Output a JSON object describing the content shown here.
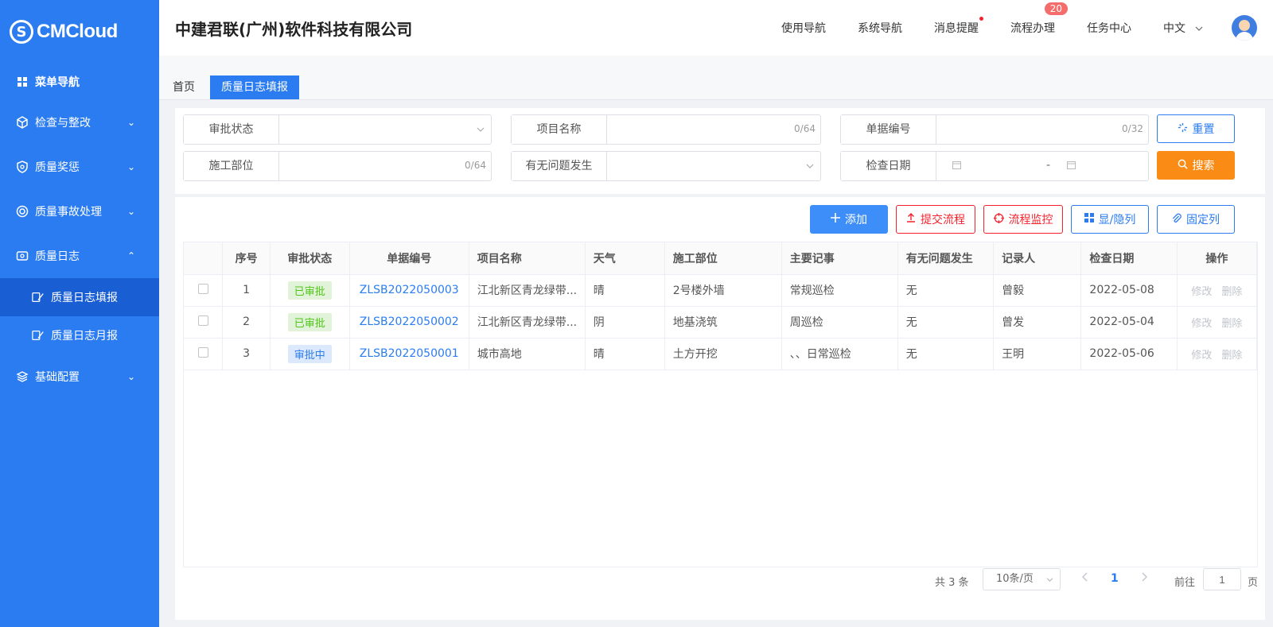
{
  "sidebar": {
    "logo_mark": "S",
    "logo_text": "CMCloud",
    "nav_title": "菜单导航",
    "items": [
      {
        "label": "检查与整改",
        "chevron": "⌄"
      },
      {
        "label": "质量奖惩",
        "chevron": "⌄"
      },
      {
        "label": "质量事故处理",
        "chevron": "⌄"
      },
      {
        "label": "质量日志",
        "chevron": "⌃"
      },
      {
        "label": "基础配置",
        "chevron": "⌄"
      }
    ],
    "sub_items": [
      {
        "label": "质量日志填报"
      },
      {
        "label": "质量日志月报"
      }
    ]
  },
  "header": {
    "company": "中建君联(广州)软件科技有限公司",
    "nav": [
      "使用导航",
      "系统导航",
      "消息提醒",
      "流程办理",
      "任务中心"
    ],
    "process_badge": "20",
    "language": "中文"
  },
  "tabs": {
    "home": "首页",
    "active": "质量日志填报"
  },
  "filters": {
    "approval_status": {
      "label": "审批状态"
    },
    "project_name": {
      "label": "项目名称",
      "counter": "0/64"
    },
    "doc_no": {
      "label": "单据编号",
      "counter": "0/32"
    },
    "construction_part": {
      "label": "施工部位",
      "counter": "0/64"
    },
    "has_issue": {
      "label": "有无问题发生"
    },
    "check_date": {
      "label": "检查日期",
      "separator": "-"
    },
    "reset_label": "重置",
    "search_label": "搜索"
  },
  "actions": {
    "add": "添加",
    "submit_flow": "提交流程",
    "flow_monitor": "流程监控",
    "show_hide_cols": "显/隐列",
    "pin_cols": "固定列"
  },
  "table": {
    "headers": [
      "序号",
      "审批状态",
      "单据编号",
      "项目名称",
      "天气",
      "施工部位",
      "主要记事",
      "有无问题发生",
      "记录人",
      "检查日期",
      "操作"
    ],
    "rows": [
      {
        "no": "1",
        "status": "已审批",
        "status_type": "ok",
        "doc": "ZLSB2022050003",
        "project": "江北新区青龙绿带...",
        "weather": "晴",
        "part": "2号楼外墙",
        "note": "常规巡检",
        "issue": "无",
        "recorder": "曾毅",
        "date": "2022-05-08",
        "edit": "修改",
        "del": "删除"
      },
      {
        "no": "2",
        "status": "已审批",
        "status_type": "ok",
        "doc": "ZLSB2022050002",
        "project": "江北新区青龙绿带...",
        "weather": "阴",
        "part": "地基浇筑",
        "note": "周巡检",
        "issue": "无",
        "recorder": "曾发",
        "date": "2022-05-04",
        "edit": "修改",
        "del": "删除"
      },
      {
        "no": "3",
        "status": "审批中",
        "status_type": "pending",
        "doc": "ZLSB2022050001",
        "project": "城市高地",
        "weather": "晴",
        "part": "土方开挖",
        "note": "、、日常巡检",
        "issue": "无",
        "recorder": "王明",
        "date": "2022-05-06",
        "edit": "修改",
        "del": "删除"
      }
    ]
  },
  "pagination": {
    "total": "共 3 条",
    "page_size": "10条/页",
    "current": "1",
    "goto_label": "前往",
    "goto_value": "1",
    "page_suffix": "页"
  },
  "colors": {
    "primary": "#2b7cf0",
    "search": "#fa8c16",
    "danger": "#f5222d",
    "approved": "#52c41a"
  }
}
